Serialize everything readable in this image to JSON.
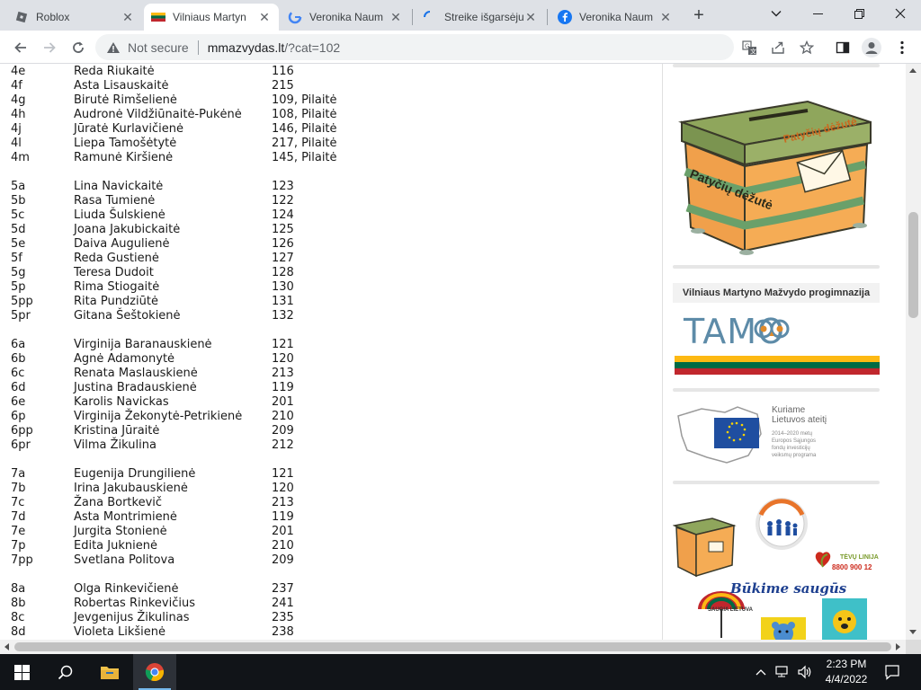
{
  "browser": {
    "tabs": [
      {
        "title": "Roblox",
        "favicon": "roblox-icon",
        "active": false
      },
      {
        "title": "Vilniaus Martyn",
        "favicon": "lithuania-flag-icon",
        "active": true
      },
      {
        "title": "Veronika Naum",
        "favicon": "google-icon",
        "active": false
      },
      {
        "title": "Streike išgarsėju",
        "favicon": "loading-spinner-icon",
        "active": false
      },
      {
        "title": "Veronika Naum",
        "favicon": "facebook-icon",
        "active": false
      }
    ],
    "new_tab_label": "+",
    "address": {
      "security_label": "Not secure",
      "host": "mmazvydas.lt",
      "path": "/?cat=102"
    }
  },
  "teachers": [
    {
      "cls": "4e",
      "name": "Reda Riukaitė",
      "room": "116"
    },
    {
      "cls": "4f",
      "name": "Asta Lisauskaitė",
      "room": "215"
    },
    {
      "cls": "4g",
      "name": "Birutė Rimšelienė",
      "room": "109, Pilaitė"
    },
    {
      "cls": "4h",
      "name": "Audronė Vildžiūnaitė-Pukėnė",
      "room": "108, Pilaitė"
    },
    {
      "cls": "4j",
      "name": "Jūratė Kurlavičienė",
      "room": "146, Pilaitė"
    },
    {
      "cls": "4l",
      "name": "Liepa Tamošėtytė",
      "room": "217, Pilaitė"
    },
    {
      "cls": "4m",
      "name": "Ramunė Kiršienė",
      "room": "145, Pilaitė"
    },
    {
      "spacer": true
    },
    {
      "cls": "5a",
      "name": "Lina Navickaitė",
      "room": "123"
    },
    {
      "cls": "5b",
      "name": "Rasa Tumienė",
      "room": "122"
    },
    {
      "cls": "5c",
      "name": "Liuda Šulskienė",
      "room": "124"
    },
    {
      "cls": "5d",
      "name": "Joana Jakubickaitė",
      "room": "125"
    },
    {
      "cls": "5e",
      "name": "Daiva Augulienė",
      "room": "126"
    },
    {
      "cls": "5f",
      "name": "Reda Gustienė",
      "room": "127"
    },
    {
      "cls": "5g",
      "name": "Teresa Dudoit",
      "room": "128"
    },
    {
      "cls": "5p",
      "name": "Rima Stiogaitė",
      "room": "130"
    },
    {
      "cls": "5pp",
      "name": "Rita Pundziūtė",
      "room": "131"
    },
    {
      "cls": "5pr",
      "name": "Gitana Šeštokienė",
      "room": "132"
    },
    {
      "spacer": true
    },
    {
      "cls": "6a",
      "name": "Virginija Baranauskienė",
      "room": "121"
    },
    {
      "cls": "6b",
      "name": "Agnė Adamonytė",
      "room": "120"
    },
    {
      "cls": "6c",
      "name": "Renata Maslauskienė",
      "room": "213"
    },
    {
      "cls": "6d",
      "name": "Justina Bradauskienė",
      "room": "119"
    },
    {
      "cls": "6e",
      "name": "Karolis Navickas",
      "room": "201"
    },
    {
      "cls": "6p",
      "name": "Virginija Žekonytė-Petrikienė",
      "room": "210"
    },
    {
      "cls": "6pp",
      "name": "Kristina Jūraitė",
      "room": "209"
    },
    {
      "cls": "6pr",
      "name": "Vilma Žikulina",
      "room": "212"
    },
    {
      "spacer": true
    },
    {
      "cls": "7a",
      "name": "Eugenija Drungilienė",
      "room": "121"
    },
    {
      "cls": "7b",
      "name": "Irina Jakubauskienė",
      "room": "120"
    },
    {
      "cls": "7c",
      "name": "Žana Bortkevič",
      "room": "213"
    },
    {
      "cls": "7d",
      "name": "Asta Montrimienė",
      "room": "119"
    },
    {
      "cls": "7e",
      "name": "Jurgita Stonienė",
      "room": "201"
    },
    {
      "cls": "7p",
      "name": "Edita Juknienė",
      "room": "210"
    },
    {
      "cls": "7pp",
      "name": "Svetlana Politova",
      "room": "209"
    },
    {
      "spacer": true
    },
    {
      "cls": "8a",
      "name": "Olga Rinkevičienė",
      "room": "237"
    },
    {
      "cls": "8b",
      "name": "Robertas Rinkevičius",
      "room": "241"
    },
    {
      "cls": "8c",
      "name": "Jevgenijus Žikulinas",
      "room": "235"
    },
    {
      "cls": "8d",
      "name": "Violeta Likšienė",
      "room": "238"
    }
  ],
  "sidebar": {
    "bully_box": {
      "lid_text": "Patyčių dėžutė",
      "front_text": "Patyčių dėžutė"
    },
    "tamo_banner": {
      "title": "Vilniaus Martyno Mažvydo progimnazija",
      "logo_text": "TAMO"
    },
    "eu_banner": {
      "heading_1": "Kuriame",
      "heading_2": "Lietuvos ateitį",
      "small_lines": [
        "2014–2020 metų",
        "Europos Sąjungos",
        "fondų investicijų",
        "veiksmų programa"
      ]
    },
    "safety_banner": {
      "slogan": "Būkime saugūs",
      "phone": "8800 900 12",
      "parents_line": "TĖVŲ LINIJA",
      "umbrella_text": "SAUGIA LIETUVA"
    }
  },
  "taskbar": {
    "time": "2:23 PM",
    "date": "4/4/2022"
  },
  "colors": {
    "tabstrip": "#dee1e6",
    "box_orange": "#f0a04b",
    "box_green": "#8aa15c",
    "taskbar": "#111418"
  }
}
